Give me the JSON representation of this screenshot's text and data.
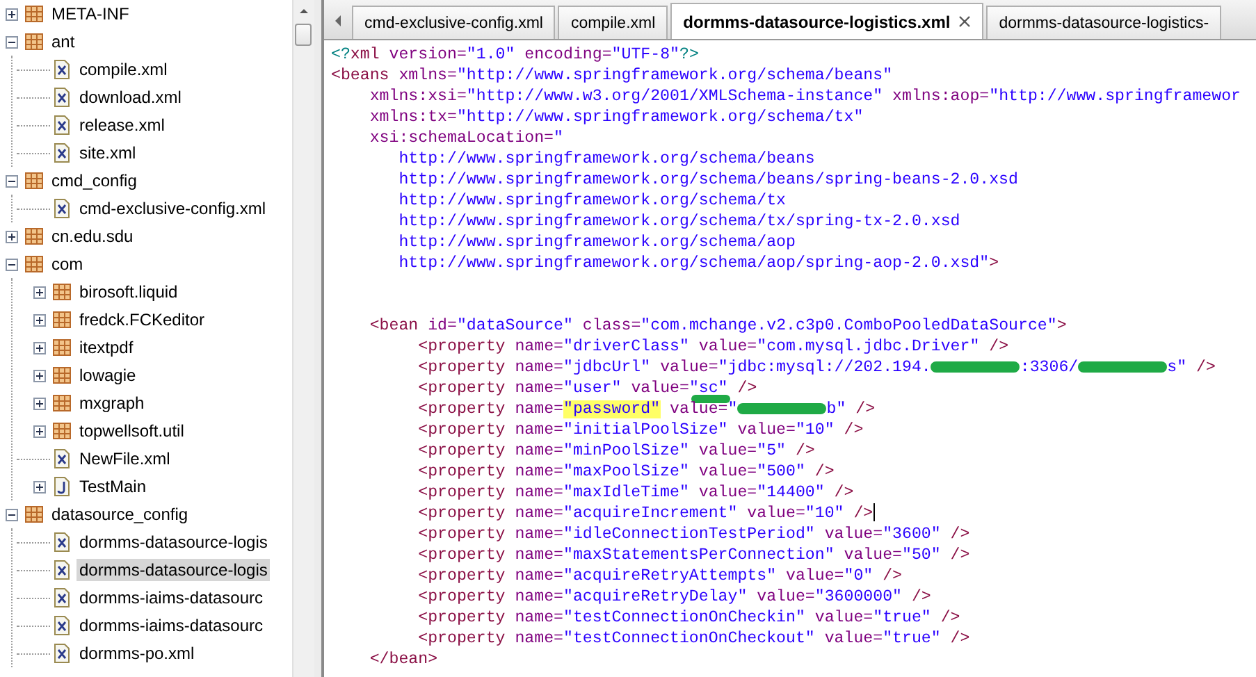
{
  "tree": [
    {
      "label": "META-INF",
      "kind": "package",
      "expanded": false,
      "selected": false
    },
    {
      "label": "ant",
      "kind": "package",
      "expanded": true,
      "selected": false,
      "children": [
        {
          "label": "compile.xml",
          "kind": "xml",
          "selected": false
        },
        {
          "label": "download.xml",
          "kind": "xml",
          "selected": false
        },
        {
          "label": "release.xml",
          "kind": "xml",
          "selected": false
        },
        {
          "label": "site.xml",
          "kind": "xml",
          "selected": false
        }
      ]
    },
    {
      "label": "cmd_config",
      "kind": "package",
      "expanded": true,
      "selected": false,
      "children": [
        {
          "label": "cmd-exclusive-config.xml",
          "kind": "xml",
          "selected": false
        }
      ]
    },
    {
      "label": "cn.edu.sdu",
      "kind": "package",
      "expanded": false,
      "selected": false
    },
    {
      "label": "com",
      "kind": "package",
      "expanded": true,
      "selected": false,
      "children": [
        {
          "label": "birosoft.liquid",
          "kind": "package",
          "expanded": false,
          "selected": false
        },
        {
          "label": "fredck.FCKeditor",
          "kind": "package",
          "expanded": false,
          "selected": false
        },
        {
          "label": "itextpdf",
          "kind": "package",
          "expanded": false,
          "selected": false
        },
        {
          "label": "lowagie",
          "kind": "package",
          "expanded": false,
          "selected": false
        },
        {
          "label": "mxgraph",
          "kind": "package",
          "expanded": false,
          "selected": false
        },
        {
          "label": "topwellsoft.util",
          "kind": "package",
          "expanded": false,
          "selected": false
        },
        {
          "label": "NewFile.xml",
          "kind": "xml",
          "selected": false
        },
        {
          "label": "TestMain",
          "kind": "java",
          "expanded": false,
          "selected": false
        }
      ]
    },
    {
      "label": "datasource_config",
      "kind": "package",
      "expanded": true,
      "selected": false,
      "children": [
        {
          "label": "dormms-datasource-logis",
          "kind": "xml",
          "selected": false
        },
        {
          "label": "dormms-datasource-logis",
          "kind": "xml",
          "selected": true
        },
        {
          "label": "dormms-iaims-datasourc",
          "kind": "xml",
          "selected": false
        },
        {
          "label": "dormms-iaims-datasourc",
          "kind": "xml",
          "selected": false
        },
        {
          "label": "dormms-po.xml",
          "kind": "xml",
          "selected": false
        }
      ]
    }
  ],
  "tabs": [
    {
      "label": "cmd-exclusive-config.xml",
      "selected": false
    },
    {
      "label": "compile.xml",
      "selected": false
    },
    {
      "label": "dormms-datasource-logistics.xml",
      "selected": true
    },
    {
      "label": "dormms-datasource-logistics-",
      "selected": false
    }
  ],
  "lines": [
    {
      "kind": "code",
      "cursor": false,
      "segments": [
        {
          "kind": "pi",
          "text": "<?"
        },
        {
          "kind": "tag",
          "text": "xml"
        },
        {
          "kind": "attr",
          "text": " version="
        },
        {
          "kind": "value",
          "text": "\"1.0\""
        },
        {
          "kind": "attr",
          "text": " encoding="
        },
        {
          "kind": "value",
          "text": "\"UTF-8\""
        },
        {
          "kind": "pi",
          "text": "?>"
        }
      ]
    },
    {
      "kind": "code",
      "cursor": false,
      "segments": [
        {
          "kind": "tag",
          "text": "<beans"
        },
        {
          "kind": "attr",
          "text": " xmlns="
        },
        {
          "kind": "value",
          "text": "\"http://www.springframework.org/schema/beans\""
        }
      ]
    },
    {
      "kind": "code",
      "cursor": false,
      "segments": [
        {
          "kind": "attr",
          "text": "    xmlns:xsi="
        },
        {
          "kind": "value",
          "text": "\"http://www.w3.org/2001/XMLSchema-instance\""
        },
        {
          "kind": "attr",
          "text": " xmlns:aop="
        },
        {
          "kind": "value",
          "text": "\"http://www.springframewor"
        }
      ]
    },
    {
      "kind": "code",
      "cursor": false,
      "segments": [
        {
          "kind": "attr",
          "text": "    xmlns:tx="
        },
        {
          "kind": "value",
          "text": "\"http://www.springframework.org/schema/tx\""
        }
      ]
    },
    {
      "kind": "code",
      "cursor": false,
      "segments": [
        {
          "kind": "attr",
          "text": "    xsi:schemaLocation="
        },
        {
          "kind": "value",
          "text": "\""
        }
      ]
    },
    {
      "kind": "code",
      "cursor": false,
      "segments": [
        {
          "kind": "value",
          "text": "       http://www.springframework.org/schema/beans"
        }
      ]
    },
    {
      "kind": "code",
      "cursor": false,
      "segments": [
        {
          "kind": "value",
          "text": "       http://www.springframework.org/schema/beans/spring-beans-2.0.xsd"
        }
      ]
    },
    {
      "kind": "code",
      "cursor": false,
      "segments": [
        {
          "kind": "value",
          "text": "       http://www.springframework.org/schema/tx"
        }
      ]
    },
    {
      "kind": "code",
      "cursor": false,
      "segments": [
        {
          "kind": "value",
          "text": "       http://www.springframework.org/schema/tx/spring-tx-2.0.xsd"
        }
      ]
    },
    {
      "kind": "code",
      "cursor": false,
      "segments": [
        {
          "kind": "value",
          "text": "       http://www.springframework.org/schema/aop"
        }
      ]
    },
    {
      "kind": "code",
      "cursor": false,
      "segments": [
        {
          "kind": "value",
          "text": "       http://www.springframework.org/schema/aop/spring-aop-2.0.xsd\""
        },
        {
          "kind": "tag",
          "text": ">"
        }
      ]
    },
    {
      "kind": "blank"
    },
    {
      "kind": "blank"
    },
    {
      "kind": "code",
      "cursor": false,
      "segments": [
        {
          "kind": "tag",
          "text": "    <bean"
        },
        {
          "kind": "attr",
          "text": " id="
        },
        {
          "kind": "value",
          "text": "\"dataSource\""
        },
        {
          "kind": "attr",
          "text": " class="
        },
        {
          "kind": "value",
          "text": "\"com.mchange.v2.c3p0.ComboPooledDataSource\""
        },
        {
          "kind": "tag",
          "text": ">"
        }
      ]
    },
    {
      "kind": "code",
      "cursor": false,
      "segments": [
        {
          "kind": "tag",
          "text": "         <property"
        },
        {
          "kind": "attr",
          "text": " name="
        },
        {
          "kind": "value",
          "text": "\"driverClass\""
        },
        {
          "kind": "attr",
          "text": " value="
        },
        {
          "kind": "value",
          "text": "\"com.mysql.jdbc.Driver\""
        },
        {
          "kind": "tag",
          "text": " />"
        }
      ]
    },
    {
      "kind": "code",
      "cursor": false,
      "segments": [
        {
          "kind": "tag",
          "text": "         <property"
        },
        {
          "kind": "attr",
          "text": " name="
        },
        {
          "kind": "value",
          "text": "\"jdbcUrl\""
        },
        {
          "kind": "attr",
          "text": " value="
        },
        {
          "kind": "value",
          "text": "\"jdbc:mysql://202.194."
        },
        {
          "kind": "redaction"
        },
        {
          "kind": "value",
          "text": ":3306/"
        },
        {
          "kind": "redaction"
        },
        {
          "kind": "value",
          "text": "s\""
        },
        {
          "kind": "tag",
          "text": " />"
        }
      ]
    },
    {
      "kind": "code",
      "cursor": false,
      "segments": [
        {
          "kind": "tag",
          "text": "         <property"
        },
        {
          "kind": "attr",
          "text": " name="
        },
        {
          "kind": "value",
          "text": "\"user\""
        },
        {
          "kind": "attr",
          "text": " value="
        },
        {
          "kind": "value",
          "text": "\"sc\"",
          "scribbled": true
        },
        {
          "kind": "tag",
          "text": " />"
        }
      ]
    },
    {
      "kind": "code",
      "cursor": false,
      "segments": [
        {
          "kind": "tag",
          "text": "         <property"
        },
        {
          "kind": "attr",
          "text": " name="
        },
        {
          "kind": "value",
          "text": "\"password\"",
          "highlighted": true
        },
        {
          "kind": "attr",
          "text": " value="
        },
        {
          "kind": "value",
          "text": "\""
        },
        {
          "kind": "redaction"
        },
        {
          "kind": "value",
          "text": "b\""
        },
        {
          "kind": "tag",
          "text": " />"
        }
      ]
    },
    {
      "kind": "code",
      "cursor": false,
      "segments": [
        {
          "kind": "tag",
          "text": "         <property"
        },
        {
          "kind": "attr",
          "text": " name="
        },
        {
          "kind": "value",
          "text": "\"initialPoolSize\""
        },
        {
          "kind": "attr",
          "text": " value="
        },
        {
          "kind": "value",
          "text": "\"10\""
        },
        {
          "kind": "tag",
          "text": " />"
        }
      ]
    },
    {
      "kind": "code",
      "cursor": false,
      "segments": [
        {
          "kind": "tag",
          "text": "         <property"
        },
        {
          "kind": "attr",
          "text": " name="
        },
        {
          "kind": "value",
          "text": "\"minPoolSize\""
        },
        {
          "kind": "attr",
          "text": " value="
        },
        {
          "kind": "value",
          "text": "\"5\""
        },
        {
          "kind": "tag",
          "text": " />"
        }
      ]
    },
    {
      "kind": "code",
      "cursor": false,
      "segments": [
        {
          "kind": "tag",
          "text": "         <property"
        },
        {
          "kind": "attr",
          "text": " name="
        },
        {
          "kind": "value",
          "text": "\"maxPoolSize\""
        },
        {
          "kind": "attr",
          "text": " value="
        },
        {
          "kind": "value",
          "text": "\"500\""
        },
        {
          "kind": "tag",
          "text": " />"
        }
      ]
    },
    {
      "kind": "code",
      "cursor": false,
      "segments": [
        {
          "kind": "tag",
          "text": "         <property"
        },
        {
          "kind": "attr",
          "text": " name="
        },
        {
          "kind": "value",
          "text": "\"maxIdleTime\""
        },
        {
          "kind": "attr",
          "text": " value="
        },
        {
          "kind": "value",
          "text": "\"14400\""
        },
        {
          "kind": "tag",
          "text": " />"
        }
      ]
    },
    {
      "kind": "code",
      "cursor": true,
      "segments": [
        {
          "kind": "tag",
          "text": "         <property"
        },
        {
          "kind": "attr",
          "text": " name="
        },
        {
          "kind": "value",
          "text": "\"acquireIncrement\""
        },
        {
          "kind": "attr",
          "text": " value="
        },
        {
          "kind": "value",
          "text": "\"10\""
        },
        {
          "kind": "tag",
          "text": " />"
        }
      ]
    },
    {
      "kind": "code",
      "cursor": false,
      "segments": [
        {
          "kind": "tag",
          "text": "         <property"
        },
        {
          "kind": "attr",
          "text": " name="
        },
        {
          "kind": "value",
          "text": "\"idleConnectionTestPeriod\""
        },
        {
          "kind": "attr",
          "text": " value="
        },
        {
          "kind": "value",
          "text": "\"3600\""
        },
        {
          "kind": "tag",
          "text": " />"
        }
      ]
    },
    {
      "kind": "code",
      "cursor": false,
      "segments": [
        {
          "kind": "tag",
          "text": "         <property"
        },
        {
          "kind": "attr",
          "text": " name="
        },
        {
          "kind": "value",
          "text": "\"maxStatementsPerConnection\""
        },
        {
          "kind": "attr",
          "text": " value="
        },
        {
          "kind": "value",
          "text": "\"50\""
        },
        {
          "kind": "tag",
          "text": " />"
        }
      ]
    },
    {
      "kind": "code",
      "cursor": false,
      "segments": [
        {
          "kind": "tag",
          "text": "         <property"
        },
        {
          "kind": "attr",
          "text": " name="
        },
        {
          "kind": "value",
          "text": "\"acquireRetryAttempts\""
        },
        {
          "kind": "attr",
          "text": " value="
        },
        {
          "kind": "value",
          "text": "\"0\""
        },
        {
          "kind": "tag",
          "text": " />"
        }
      ]
    },
    {
      "kind": "code",
      "cursor": false,
      "segments": [
        {
          "kind": "tag",
          "text": "         <property"
        },
        {
          "kind": "attr",
          "text": " name="
        },
        {
          "kind": "value",
          "text": "\"acquireRetryDelay\""
        },
        {
          "kind": "attr",
          "text": " value="
        },
        {
          "kind": "value",
          "text": "\"3600000\""
        },
        {
          "kind": "tag",
          "text": " />"
        }
      ]
    },
    {
      "kind": "code",
      "cursor": false,
      "segments": [
        {
          "kind": "tag",
          "text": "         <property"
        },
        {
          "kind": "attr",
          "text": " name="
        },
        {
          "kind": "value",
          "text": "\"testConnectionOnCheckin\""
        },
        {
          "kind": "attr",
          "text": " value="
        },
        {
          "kind": "value",
          "text": "\"true\""
        },
        {
          "kind": "tag",
          "text": " />"
        }
      ]
    },
    {
      "kind": "code",
      "cursor": false,
      "segments": [
        {
          "kind": "tag",
          "text": "         <property"
        },
        {
          "kind": "attr",
          "text": " name="
        },
        {
          "kind": "value",
          "text": "\"testConnectionOnCheckout\""
        },
        {
          "kind": "attr",
          "text": " value="
        },
        {
          "kind": "value",
          "text": "\"true\""
        },
        {
          "kind": "tag",
          "text": " />"
        }
      ]
    },
    {
      "kind": "code",
      "cursor": false,
      "segments": [
        {
          "kind": "tag",
          "text": "    </bean>"
        }
      ]
    }
  ]
}
